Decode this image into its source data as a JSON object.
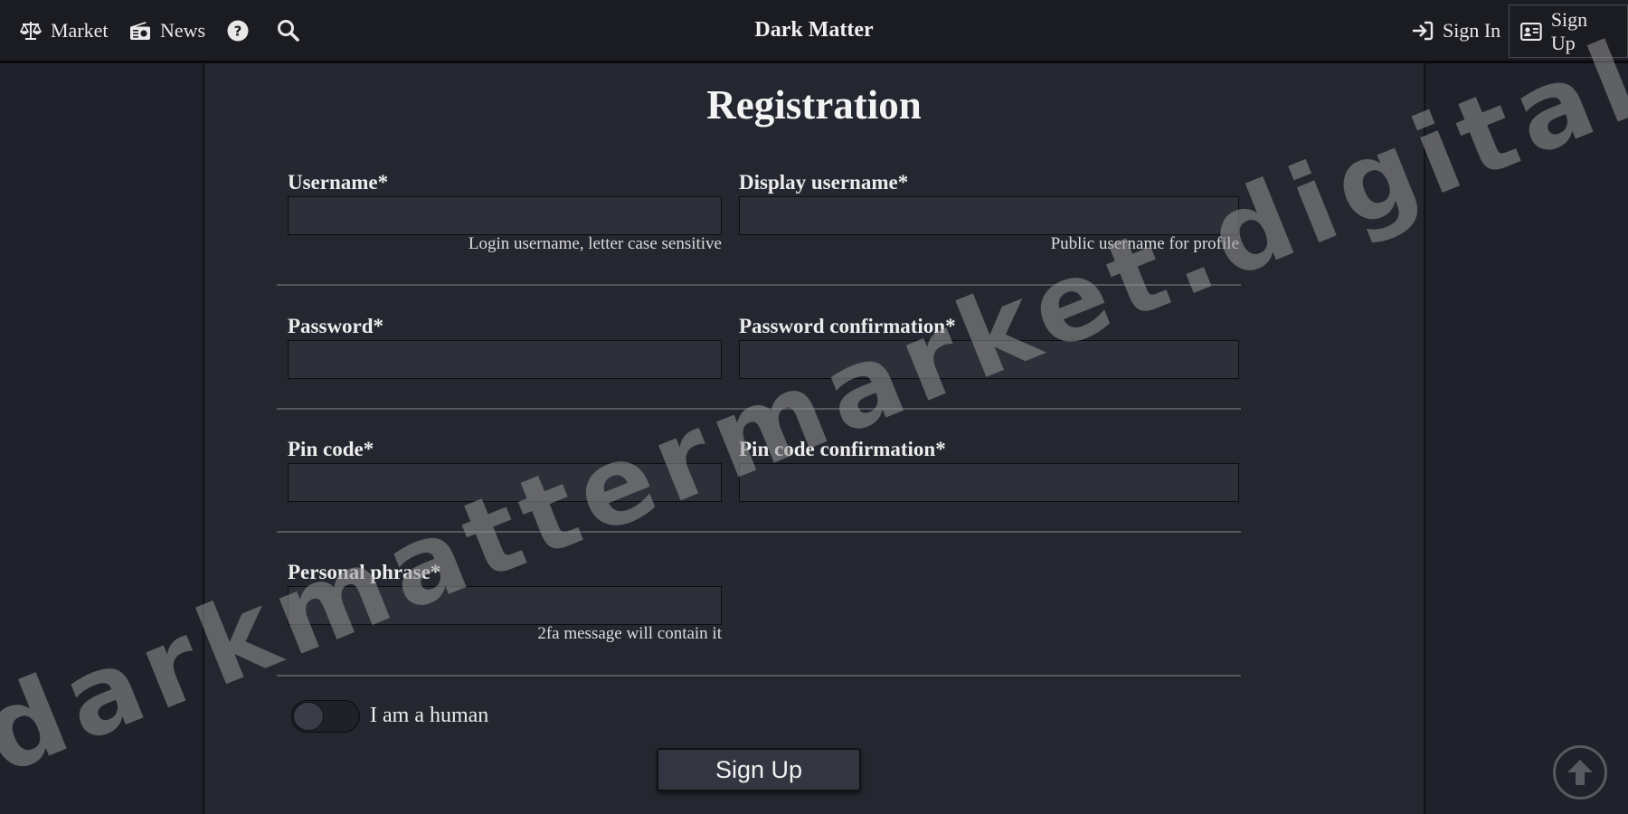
{
  "nav": {
    "market": "Market",
    "news": "News",
    "brand": "Dark Matter",
    "sign_in": "Sign In",
    "sign_up": "Sign Up"
  },
  "form": {
    "title": "Registration",
    "username": {
      "label": "Username*",
      "value": "",
      "help": "Login username, letter case sensitive"
    },
    "display_username": {
      "label": "Display username*",
      "value": "",
      "help": "Public username for profile"
    },
    "password": {
      "label": "Password*",
      "value": ""
    },
    "password_confirmation": {
      "label": "Password confirmation*",
      "value": ""
    },
    "pin_code": {
      "label": "Pin code*",
      "value": ""
    },
    "pin_code_confirmation": {
      "label": "Pin code confirmation*",
      "value": ""
    },
    "personal_phrase": {
      "label": "Personal phrase*",
      "value": "",
      "help": "2fa message will contain it"
    },
    "human_check": {
      "label": "I am a human",
      "checked": false
    },
    "submit": "Sign Up"
  },
  "watermark": "darkmattermarket.digital",
  "colors": {
    "background": "#20222b",
    "panel": "#252730",
    "navbar": "#1b1c22",
    "input": "#2d2f39"
  },
  "icons": {
    "market": "balance-scale-icon",
    "news": "radio-icon",
    "help": "question-circle-icon",
    "search": "search-icon",
    "sign_in": "sign-in-icon",
    "sign_up": "id-card-icon",
    "scroll_top": "arrow-up-circle-icon"
  }
}
